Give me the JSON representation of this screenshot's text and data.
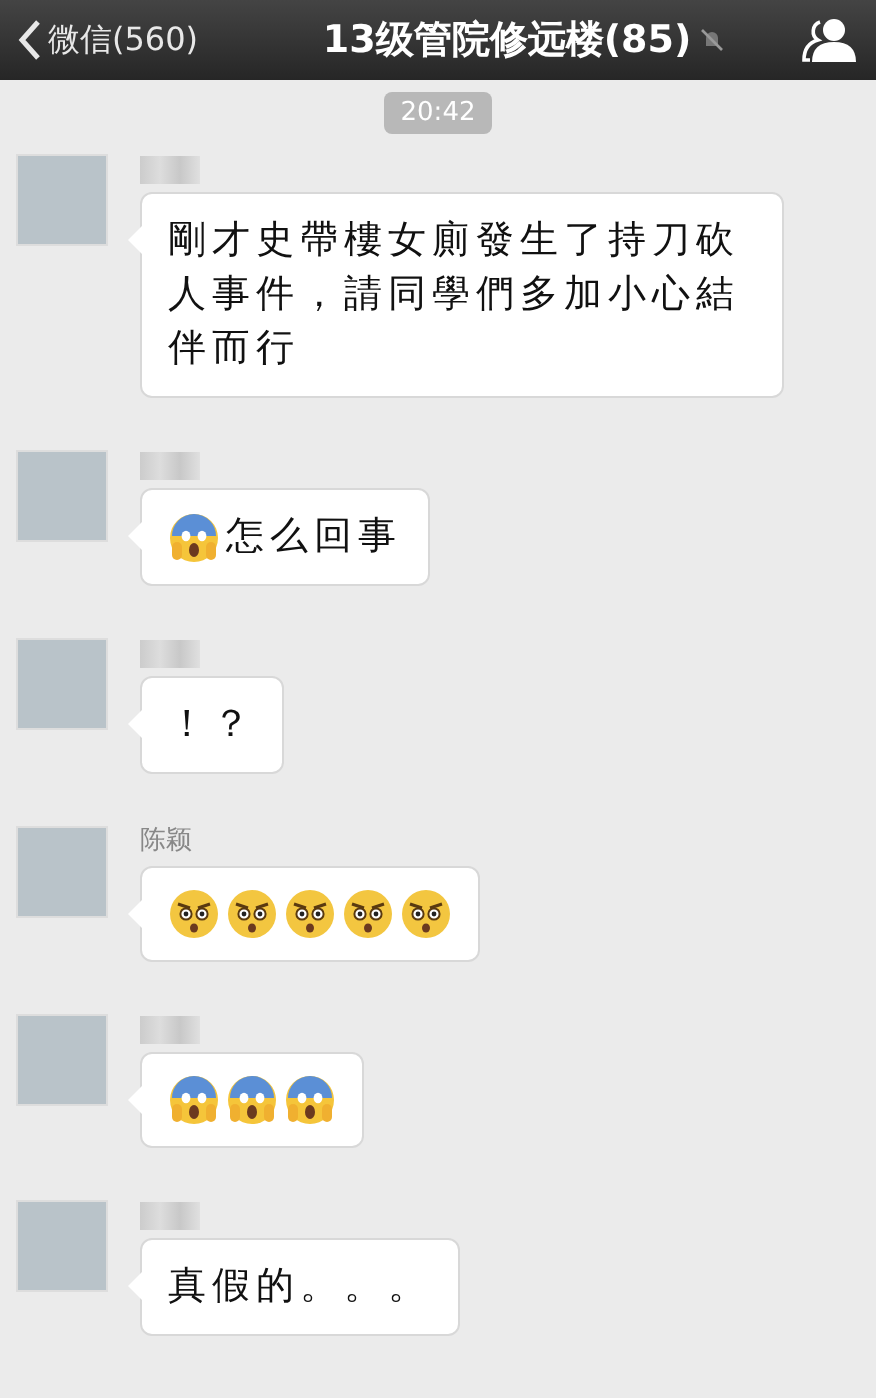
{
  "header": {
    "back_label": "微信(560)",
    "title": "13级管院修远楼(85)",
    "muted": true
  },
  "timestamp": "20:42",
  "messages": [
    {
      "sender": {
        "blurred": true
      },
      "content": [
        {
          "kind": "text",
          "text": "剛才史帶樓女廁發生了持刀砍人事件，請同學們多加小心結伴而行"
        }
      ]
    },
    {
      "sender": {
        "blurred": true
      },
      "content": [
        {
          "kind": "scream"
        },
        {
          "kind": "text",
          "text": "怎么回事"
        }
      ]
    },
    {
      "sender": {
        "blurred": true
      },
      "content": [
        {
          "kind": "text",
          "text": "！？"
        }
      ]
    },
    {
      "sender": {
        "blurred": false,
        "name": "陈颖"
      },
      "content": [
        {
          "kind": "glare"
        },
        {
          "kind": "glare"
        },
        {
          "kind": "glare"
        },
        {
          "kind": "glare"
        },
        {
          "kind": "glare"
        }
      ]
    },
    {
      "sender": {
        "blurred": true
      },
      "content": [
        {
          "kind": "scream"
        },
        {
          "kind": "scream"
        },
        {
          "kind": "scream"
        }
      ]
    },
    {
      "sender": {
        "blurred": true
      },
      "content": [
        {
          "kind": "text",
          "text": "真假的。。。"
        }
      ]
    }
  ]
}
